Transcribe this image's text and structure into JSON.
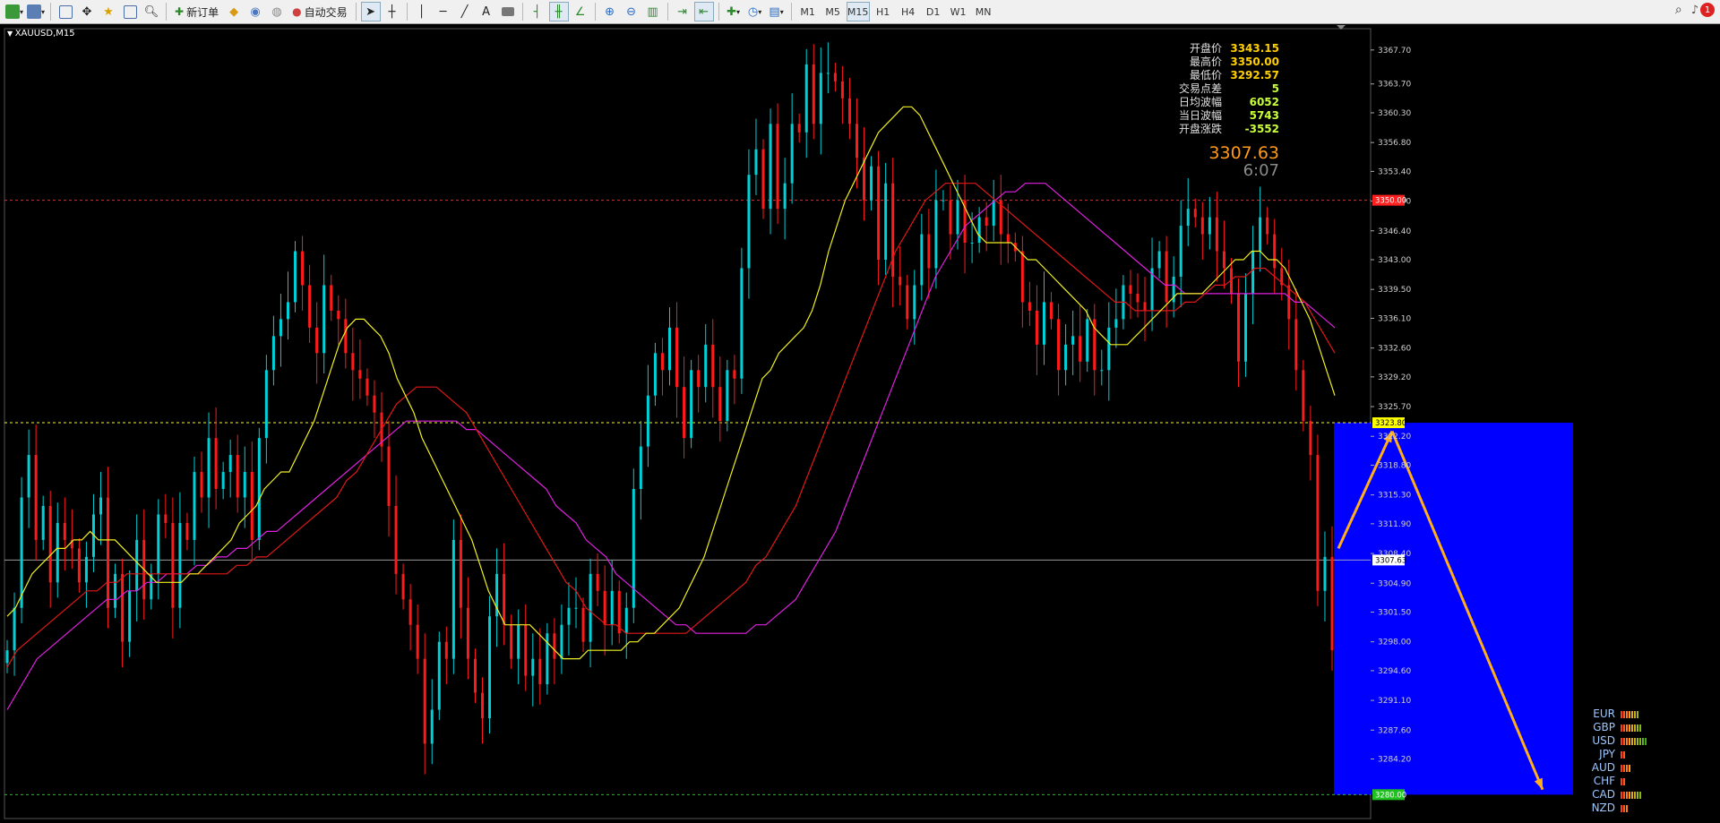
{
  "toolbar": {
    "new_order_label": "新订单",
    "auto_trade_label": "自动交易",
    "timeframes": [
      "M1",
      "M5",
      "M15",
      "H1",
      "H4",
      "D1",
      "W1",
      "MN"
    ],
    "active_timeframe": "M15",
    "alert_count": "1",
    "text_tool_label": "A"
  },
  "chart": {
    "title": "XAUUSD,M15",
    "y_range": [
      3277.4,
      3370.0
    ],
    "y_ticks": [
      "3367.70",
      "3363.70",
      "3360.30",
      "3356.80",
      "3353.40",
      "3349.90",
      "3346.40",
      "3343.00",
      "3339.50",
      "3336.10",
      "3332.60",
      "3329.20",
      "3325.70",
      "3322.20",
      "3318.80",
      "3315.30",
      "3311.90",
      "3308.40",
      "3304.90",
      "3301.50",
      "3298.00",
      "3294.60",
      "3291.10",
      "3287.60",
      "3284.20"
    ],
    "horizontal_levels": [
      {
        "price": 3350.0,
        "label": "3350.00",
        "color": "#ff2020"
      },
      {
        "price": 3323.8,
        "label": "3323.80",
        "color": "#ffff00"
      },
      {
        "price": 3307.63,
        "label": "3307.63",
        "color": "#c0c0c0"
      },
      {
        "price": 3280.0,
        "label": "3280.00",
        "color": "#20c020"
      }
    ],
    "projection_box": {
      "top_price": 3323.8,
      "bottom_price": 3280.0,
      "color": "#0000ff"
    },
    "arrows": [
      {
        "from_price": 3309.0,
        "to_price": 3322.8,
        "color": "#ffae1a"
      },
      {
        "from_price": 3322.8,
        "to_price": 3280.6,
        "color": "#ffae1a"
      }
    ],
    "close_series": [
      3297,
      3302,
      3315,
      3320,
      3310,
      3314,
      3305,
      3312,
      3310,
      3309,
      3305,
      3308,
      3313,
      3315,
      3302,
      3306,
      3298,
      3304,
      3310,
      3303,
      3306,
      3313,
      3312,
      3302,
      3312,
      3310,
      3318,
      3315,
      3322,
      3316,
      3318,
      3320,
      3315,
      3318,
      3310,
      3322,
      3330,
      3334,
      3336,
      3338,
      3344,
      3340,
      3335,
      3332,
      3340,
      3337,
      3336,
      3332,
      3330,
      3329,
      3327,
      3325,
      3321,
      3314,
      3306,
      3303,
      3300,
      3296,
      3286,
      3290,
      3298,
      3296,
      3310,
      3302,
      3296,
      3292,
      3289,
      3301,
      3306,
      3300,
      3296,
      3300,
      3294,
      3296,
      3293,
      3299,
      3296,
      3300,
      3302,
      3302,
      3298,
      3306,
      3304,
      3300,
      3304,
      3299,
      3302,
      3316,
      3321,
      3327,
      3332,
      3330,
      3335,
      3328,
      3322,
      3330,
      3328,
      3333,
      3328,
      3324,
      3330,
      3329,
      3342,
      3353,
      3356,
      3349,
      3359,
      3349,
      3352,
      3359,
      3358,
      3366,
      3359,
      3365,
      3365,
      3364,
      3362,
      3359,
      3355,
      3350,
      3354,
      3343,
      3352,
      3341,
      3340,
      3336,
      3340,
      3346,
      3342,
      3350,
      3350,
      3346,
      3350,
      3345,
      3345,
      3348,
      3347,
      3350,
      3346,
      3345,
      3344,
      3338,
      3337,
      3333,
      3338,
      3336,
      3330,
      3333,
      3334,
      3331,
      3336,
      3330,
      3330,
      3335,
      3336,
      3340,
      3339,
      3338,
      3337,
      3342,
      3344,
      3338,
      3341,
      3347,
      3349,
      3348,
      3346,
      3348,
      3344,
      3342,
      3339,
      3331,
      3339,
      3344,
      3348,
      3346,
      3342,
      3340,
      3336,
      3330,
      3324,
      3320,
      3304,
      3308,
      3297
    ],
    "ma_fast": [
      3301,
      3302,
      3304,
      3306,
      3307,
      3308,
      3309,
      3309,
      3310,
      3310,
      3311,
      3310,
      3310,
      3310,
      3309,
      3308,
      3307,
      3306,
      3305,
      3305,
      3305,
      3305,
      3306,
      3306,
      3307,
      3308,
      3309,
      3310,
      3312,
      3313,
      3314,
      3316,
      3317,
      3318,
      3318,
      3320,
      3322,
      3324,
      3327,
      3330,
      3333,
      3335,
      3336,
      3336,
      3335,
      3334,
      3332,
      3329,
      3327,
      3325,
      3322,
      3320,
      3318,
      3316,
      3314,
      3312,
      3310,
      3307,
      3304,
      3302,
      3300,
      3300,
      3300,
      3300,
      3299,
      3298,
      3297,
      3296,
      3296,
      3296,
      3297,
      3297,
      3297,
      3297,
      3297,
      3298,
      3298,
      3299,
      3299,
      3300,
      3301,
      3302,
      3304,
      3306,
      3308,
      3311,
      3314,
      3317,
      3320,
      3323,
      3326,
      3329,
      3330,
      3332,
      3333,
      3334,
      3335,
      3337,
      3340,
      3344,
      3347,
      3350,
      3352,
      3354,
      3356,
      3358,
      3359,
      3360,
      3361,
      3361,
      3360,
      3358,
      3356,
      3354,
      3352,
      3350,
      3348,
      3346,
      3345,
      3345,
      3345,
      3345,
      3344,
      3343,
      3343,
      3342,
      3341,
      3340,
      3339,
      3338,
      3337,
      3335,
      3334,
      3333,
      3333,
      3333,
      3334,
      3335,
      3336,
      3337,
      3338,
      3339,
      3339,
      3339,
      3339,
      3340,
      3341,
      3342,
      3343,
      3343,
      3344,
      3344,
      3343,
      3343,
      3342,
      3340,
      3338,
      3336,
      3333,
      3330,
      3327
    ],
    "ma_mid": [
      3295,
      3297,
      3298,
      3299,
      3300,
      3301,
      3302,
      3303,
      3304,
      3304,
      3305,
      3305,
      3306,
      3306,
      3306,
      3306,
      3306,
      3306,
      3306,
      3306,
      3306,
      3306,
      3306,
      3307,
      3307,
      3308,
      3308,
      3309,
      3310,
      3311,
      3312,
      3313,
      3314,
      3315,
      3317,
      3318,
      3320,
      3322,
      3324,
      3326,
      3327,
      3328,
      3328,
      3328,
      3327,
      3326,
      3325,
      3323,
      3321,
      3319,
      3317,
      3315,
      3313,
      3311,
      3309,
      3307,
      3305,
      3304,
      3302,
      3301,
      3300,
      3300,
      3299,
      3299,
      3299,
      3299,
      3299,
      3299,
      3299,
      3300,
      3301,
      3302,
      3303,
      3304,
      3305,
      3307,
      3308,
      3310,
      3312,
      3314,
      3317,
      3320,
      3323,
      3326,
      3329,
      3332,
      3335,
      3338,
      3341,
      3344,
      3346,
      3348,
      3350,
      3351,
      3352,
      3352,
      3352,
      3352,
      3351,
      3350,
      3349,
      3348,
      3347,
      3346,
      3345,
      3344,
      3343,
      3342,
      3341,
      3340,
      3339,
      3338,
      3338,
      3337,
      3337,
      3337,
      3337,
      3337,
      3338,
      3338,
      3339,
      3340,
      3340,
      3341,
      3341,
      3342,
      3342,
      3341,
      3340,
      3339,
      3338,
      3336,
      3334,
      3332
    ],
    "ma_slow": [
      3290,
      3292,
      3294,
      3296,
      3297,
      3298,
      3299,
      3300,
      3301,
      3302,
      3303,
      3303,
      3304,
      3304,
      3305,
      3305,
      3306,
      3306,
      3306,
      3307,
      3307,
      3308,
      3308,
      3309,
      3309,
      3310,
      3311,
      3311,
      3312,
      3313,
      3314,
      3315,
      3316,
      3317,
      3318,
      3319,
      3320,
      3321,
      3322,
      3323,
      3324,
      3324,
      3324,
      3324,
      3324,
      3324,
      3323,
      3323,
      3322,
      3321,
      3320,
      3319,
      3318,
      3317,
      3316,
      3314,
      3313,
      3312,
      3310,
      3309,
      3308,
      3306,
      3305,
      3304,
      3303,
      3302,
      3301,
      3300,
      3300,
      3299,
      3299,
      3299,
      3299,
      3299,
      3299,
      3300,
      3300,
      3301,
      3302,
      3303,
      3305,
      3307,
      3309,
      3311,
      3314,
      3317,
      3320,
      3323,
      3326,
      3329,
      3332,
      3335,
      3338,
      3341,
      3343,
      3345,
      3347,
      3348,
      3349,
      3350,
      3351,
      3351,
      3352,
      3352,
      3352,
      3351,
      3350,
      3349,
      3348,
      3347,
      3346,
      3345,
      3344,
      3343,
      3342,
      3341,
      3340,
      3340,
      3339,
      3339,
      3339,
      3339,
      3339,
      3339,
      3339,
      3339,
      3339,
      3339,
      3339,
      3338,
      3338,
      3337,
      3336,
      3335
    ]
  },
  "stats": [
    {
      "label": "开盘价",
      "value": "3343.15",
      "green": false
    },
    {
      "label": "最高价",
      "value": "3350.00",
      "green": false
    },
    {
      "label": "最低价",
      "value": "3292.57",
      "green": false
    },
    {
      "label": "交易点差",
      "value": "5",
      "green": true
    },
    {
      "label": "日均波幅",
      "value": "6052",
      "green": true
    },
    {
      "label": "当日波幅",
      "value": "5743",
      "green": true
    },
    {
      "label": "开盘涨跌",
      "value": "-3552",
      "green": true
    }
  ],
  "current_price": "3307.63",
  "bar_timer": "6:07",
  "currency_strength": [
    {
      "name": "EUR",
      "bars": 7
    },
    {
      "name": "GBP",
      "bars": 8
    },
    {
      "name": "USD",
      "bars": 10
    },
    {
      "name": "JPY",
      "bars": 2
    },
    {
      "name": "AUD",
      "bars": 4
    },
    {
      "name": "CHF",
      "bars": 2
    },
    {
      "name": "CAD",
      "bars": 8
    },
    {
      "name": "NZD",
      "bars": 3
    }
  ]
}
